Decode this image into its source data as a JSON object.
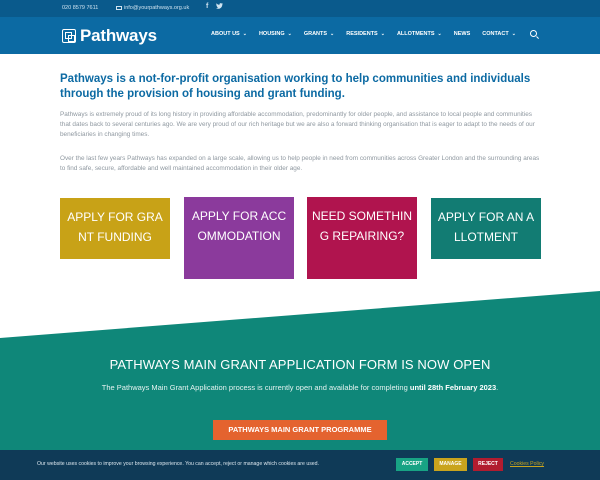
{
  "topbar": {
    "phone": "020 8579 7611",
    "email": "info@yourpathways.org.uk",
    "facebook_glyph": "f",
    "twitter_glyph": "🐦"
  },
  "header": {
    "logo_text": "Pathways",
    "nav": [
      {
        "label": "ABOUT US",
        "has_dropdown": true
      },
      {
        "label": "HOUSING",
        "has_dropdown": true
      },
      {
        "label": "GRANTS",
        "has_dropdown": true
      },
      {
        "label": "RESIDENTS",
        "has_dropdown": true
      },
      {
        "label": "ALLOTMENTS",
        "has_dropdown": true
      },
      {
        "label": "NEWS",
        "has_dropdown": false
      },
      {
        "label": "CONTACT",
        "has_dropdown": true
      }
    ],
    "chevron": "⌄"
  },
  "intro": {
    "title": "Pathways is a not-for-profit organisation working to help communities and individuals through the provision of housing and grant funding.",
    "paragraph1": "Pathways is extremely proud of its long history in providing affordable accommodation, predominantly for older people, and assistance to local people and communities that dates back to several centuries ago. We are very proud of our rich heritage but we are also a forward thinking organisation that is eager to adapt to the needs of our beneficiaries in changing times.",
    "paragraph2": "Over the last few years Pathways has expanded on a large scale, allowing us to help people in need from communities across Greater London and the surrounding areas to find safe, secure, affordable and well maintained accommodation in their older age."
  },
  "cards": {
    "grant": "APPLY FOR GRANT FUNDING",
    "accommodation": "APPLY FOR ACCOMMODATION",
    "repair": "NEED SOMETHING REPAIRING?",
    "allotment": "APPLY FOR AN ALLOTMENT"
  },
  "grant_section": {
    "title": "PATHWAYS MAIN GRANT APPLICATION FORM IS NOW OPEN",
    "desc_prefix": "The Pathways Main Grant Application process is currently open and available for completing ",
    "desc_bold": "until 28th February 2023",
    "desc_suffix": ".",
    "cta_label": "PATHWAYS MAIN GRANT PROGRAMME"
  },
  "cookie": {
    "text": "Our website uses cookies to improve your browsing experience. You can accept, reject or manage which cookies are used.",
    "accept": "ACCEPT",
    "manage": "MANAGE",
    "reject": "REJECT",
    "policy": "Cookies Policy"
  },
  "colors": {
    "topbar": "#0a5a8c",
    "header": "#0c6aa3",
    "grant_card": "#c8a217",
    "accommodation_card": "#8b3a9c",
    "repair_card": "#b0144e",
    "allotment_card": "#127c73",
    "teal_section": "#0f8779",
    "cta": "#e4632f",
    "cookie_bar": "#0f3a57"
  }
}
